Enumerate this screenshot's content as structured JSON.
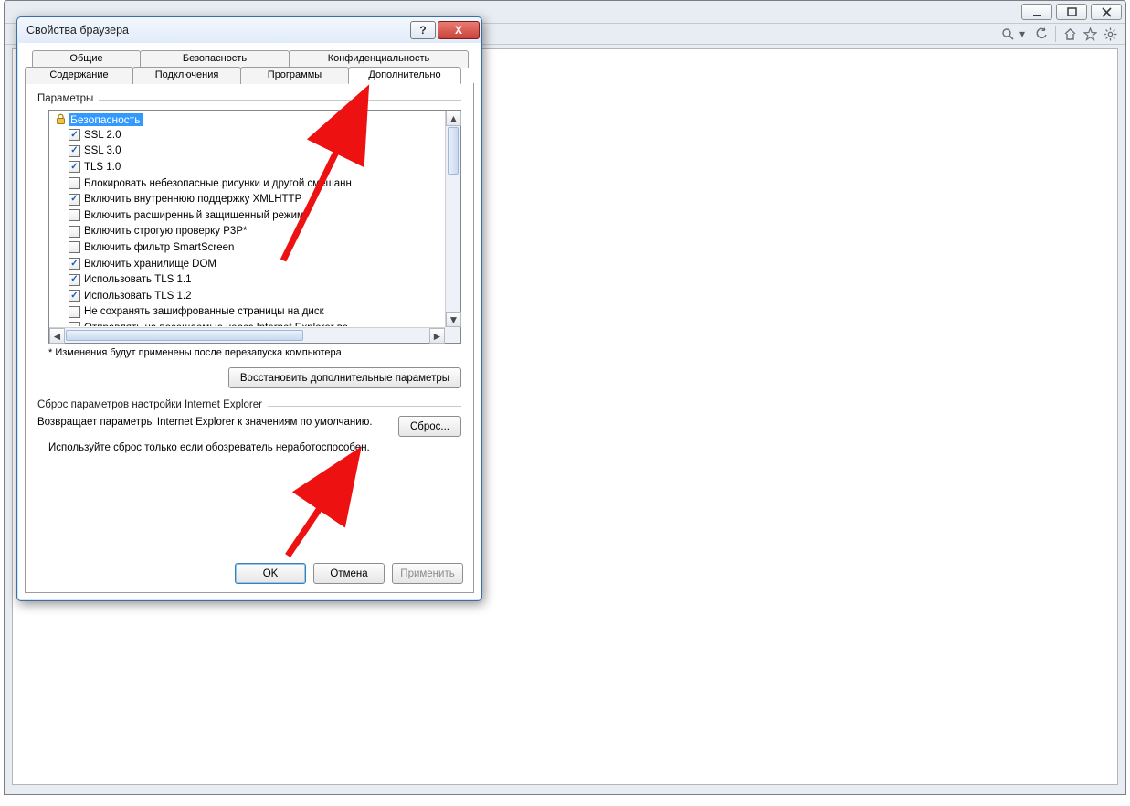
{
  "dialog": {
    "title": "Свойства браузера",
    "tabs_row1": [
      "Общие",
      "Безопасность",
      "Конфиденциальность"
    ],
    "tabs_row2": [
      "Содержание",
      "Подключения",
      "Программы",
      "Дополнительно"
    ],
    "group_params": "Параметры",
    "category": "Безопасность",
    "items": [
      {
        "label": "SSL 2.0",
        "checked": true
      },
      {
        "label": "SSL 3.0",
        "checked": true
      },
      {
        "label": "TLS 1.0",
        "checked": true
      },
      {
        "label": "Блокировать небезопасные рисунки и другой смешанн",
        "checked": false
      },
      {
        "label": "Включить внутреннюю поддержку XMLHTTP",
        "checked": true
      },
      {
        "label": "Включить расширенный защищенный режим*",
        "checked": false
      },
      {
        "label": "Включить строгую проверку P3P*",
        "checked": false
      },
      {
        "label": "Включить фильтр SmartScreen",
        "checked": false
      },
      {
        "label": "Включить хранилище DOM",
        "checked": true
      },
      {
        "label": "Использовать TLS 1.1",
        "checked": true
      },
      {
        "label": "Использовать TLS 1.2",
        "checked": true
      },
      {
        "label": "Не сохранять зашифрованные страницы на диск",
        "checked": false
      },
      {
        "label": "Отправлять на посещаемые через Internet Explorer ве",
        "checked": false
      }
    ],
    "note_restart": "* Изменения будут применены после перезапуска компьютера",
    "btn_restore": "Восстановить дополнительные параметры",
    "group_reset": "Сброс параметров настройки Internet Explorer",
    "reset_text": "Возвращает параметры Internet Explorer к значениям по умолчанию.",
    "btn_reset": "Сброс...",
    "reset_hint": "Используйте сброс только если обозреватель неработоспособен.",
    "btn_ok": "OK",
    "btn_cancel": "Отмена",
    "btn_apply": "Применить",
    "help_symbol": "?",
    "close_symbol": "X"
  }
}
